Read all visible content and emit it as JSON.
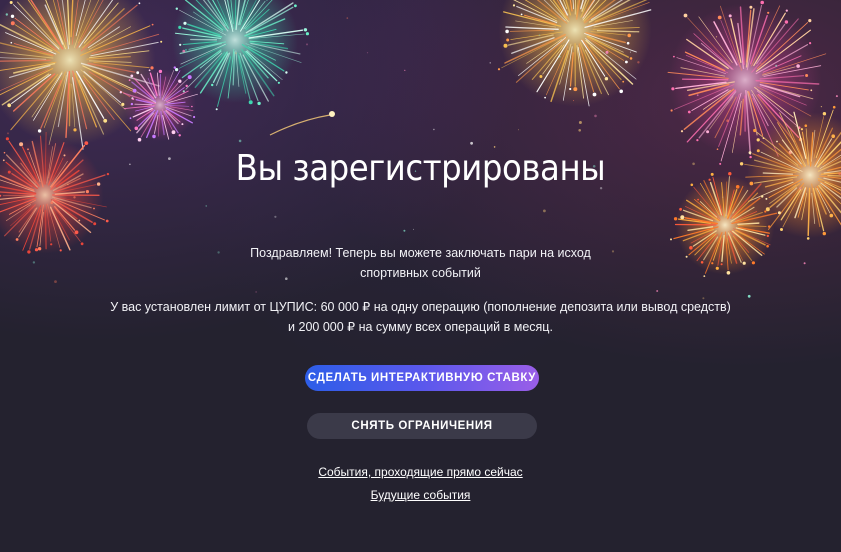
{
  "page": {
    "title": "Вы зарегистрированы",
    "congrats_line1": "Поздравляем! Теперь вы можете заключать пари на исход",
    "congrats_line2": "спортивных событий",
    "limit_line1": "У вас установлен лимит от ЦУПИС: 60 000  ₽ на одну операцию (пополнение депозита или вывод средств)",
    "limit_line2": "и 200 000  ₽ на сумму всех операций в месяц."
  },
  "actions": {
    "primary_label": "СДЕЛАТЬ ИНТЕРАКТИВНУЮ СТАВКУ",
    "secondary_label": "СНЯТЬ ОГРАНИЧЕНИЯ"
  },
  "links": {
    "live_events": "События, проходящие прямо сейчас",
    "future_events": "Будущие события"
  },
  "colors": {
    "background": "#24222f",
    "primary_gradient_start": "#2d5ee8",
    "primary_gradient_end": "#9a5ee8",
    "secondary_button": "#3b3a49"
  },
  "decor": {
    "background_image": "fireworks"
  }
}
